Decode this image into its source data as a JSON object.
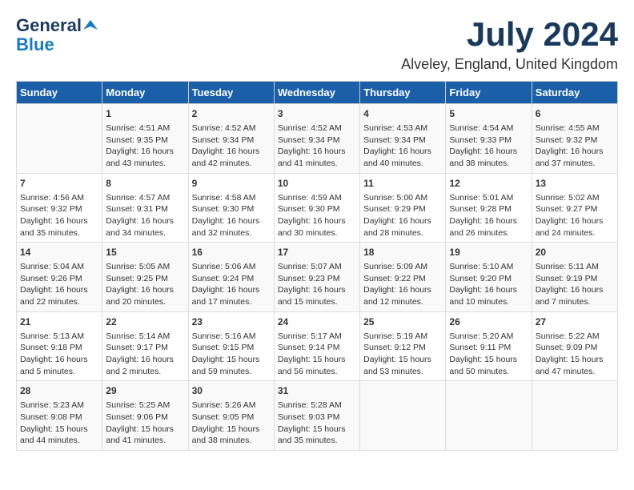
{
  "logo": {
    "general": "General",
    "blue": "Blue"
  },
  "header": {
    "month_year": "July 2024",
    "location": "Alveley, England, United Kingdom"
  },
  "weekdays": [
    "Sunday",
    "Monday",
    "Tuesday",
    "Wednesday",
    "Thursday",
    "Friday",
    "Saturday"
  ],
  "weeks": [
    [
      {
        "day": "",
        "info": ""
      },
      {
        "day": "1",
        "info": "Sunrise: 4:51 AM\nSunset: 9:35 PM\nDaylight: 16 hours\nand 43 minutes."
      },
      {
        "day": "2",
        "info": "Sunrise: 4:52 AM\nSunset: 9:34 PM\nDaylight: 16 hours\nand 42 minutes."
      },
      {
        "day": "3",
        "info": "Sunrise: 4:52 AM\nSunset: 9:34 PM\nDaylight: 16 hours\nand 41 minutes."
      },
      {
        "day": "4",
        "info": "Sunrise: 4:53 AM\nSunset: 9:34 PM\nDaylight: 16 hours\nand 40 minutes."
      },
      {
        "day": "5",
        "info": "Sunrise: 4:54 AM\nSunset: 9:33 PM\nDaylight: 16 hours\nand 38 minutes."
      },
      {
        "day": "6",
        "info": "Sunrise: 4:55 AM\nSunset: 9:32 PM\nDaylight: 16 hours\nand 37 minutes."
      }
    ],
    [
      {
        "day": "7",
        "info": "Sunrise: 4:56 AM\nSunset: 9:32 PM\nDaylight: 16 hours\nand 35 minutes."
      },
      {
        "day": "8",
        "info": "Sunrise: 4:57 AM\nSunset: 9:31 PM\nDaylight: 16 hours\nand 34 minutes."
      },
      {
        "day": "9",
        "info": "Sunrise: 4:58 AM\nSunset: 9:30 PM\nDaylight: 16 hours\nand 32 minutes."
      },
      {
        "day": "10",
        "info": "Sunrise: 4:59 AM\nSunset: 9:30 PM\nDaylight: 16 hours\nand 30 minutes."
      },
      {
        "day": "11",
        "info": "Sunrise: 5:00 AM\nSunset: 9:29 PM\nDaylight: 16 hours\nand 28 minutes."
      },
      {
        "day": "12",
        "info": "Sunrise: 5:01 AM\nSunset: 9:28 PM\nDaylight: 16 hours\nand 26 minutes."
      },
      {
        "day": "13",
        "info": "Sunrise: 5:02 AM\nSunset: 9:27 PM\nDaylight: 16 hours\nand 24 minutes."
      }
    ],
    [
      {
        "day": "14",
        "info": "Sunrise: 5:04 AM\nSunset: 9:26 PM\nDaylight: 16 hours\nand 22 minutes."
      },
      {
        "day": "15",
        "info": "Sunrise: 5:05 AM\nSunset: 9:25 PM\nDaylight: 16 hours\nand 20 minutes."
      },
      {
        "day": "16",
        "info": "Sunrise: 5:06 AM\nSunset: 9:24 PM\nDaylight: 16 hours\nand 17 minutes."
      },
      {
        "day": "17",
        "info": "Sunrise: 5:07 AM\nSunset: 9:23 PM\nDaylight: 16 hours\nand 15 minutes."
      },
      {
        "day": "18",
        "info": "Sunrise: 5:09 AM\nSunset: 9:22 PM\nDaylight: 16 hours\nand 12 minutes."
      },
      {
        "day": "19",
        "info": "Sunrise: 5:10 AM\nSunset: 9:20 PM\nDaylight: 16 hours\nand 10 minutes."
      },
      {
        "day": "20",
        "info": "Sunrise: 5:11 AM\nSunset: 9:19 PM\nDaylight: 16 hours\nand 7 minutes."
      }
    ],
    [
      {
        "day": "21",
        "info": "Sunrise: 5:13 AM\nSunset: 9:18 PM\nDaylight: 16 hours\nand 5 minutes."
      },
      {
        "day": "22",
        "info": "Sunrise: 5:14 AM\nSunset: 9:17 PM\nDaylight: 16 hours\nand 2 minutes."
      },
      {
        "day": "23",
        "info": "Sunrise: 5:16 AM\nSunset: 9:15 PM\nDaylight: 15 hours\nand 59 minutes."
      },
      {
        "day": "24",
        "info": "Sunrise: 5:17 AM\nSunset: 9:14 PM\nDaylight: 15 hours\nand 56 minutes."
      },
      {
        "day": "25",
        "info": "Sunrise: 5:19 AM\nSunset: 9:12 PM\nDaylight: 15 hours\nand 53 minutes."
      },
      {
        "day": "26",
        "info": "Sunrise: 5:20 AM\nSunset: 9:11 PM\nDaylight: 15 hours\nand 50 minutes."
      },
      {
        "day": "27",
        "info": "Sunrise: 5:22 AM\nSunset: 9:09 PM\nDaylight: 15 hours\nand 47 minutes."
      }
    ],
    [
      {
        "day": "28",
        "info": "Sunrise: 5:23 AM\nSunset: 9:08 PM\nDaylight: 15 hours\nand 44 minutes."
      },
      {
        "day": "29",
        "info": "Sunrise: 5:25 AM\nSunset: 9:06 PM\nDaylight: 15 hours\nand 41 minutes."
      },
      {
        "day": "30",
        "info": "Sunrise: 5:26 AM\nSunset: 9:05 PM\nDaylight: 15 hours\nand 38 minutes."
      },
      {
        "day": "31",
        "info": "Sunrise: 5:28 AM\nSunset: 9:03 PM\nDaylight: 15 hours\nand 35 minutes."
      },
      {
        "day": "",
        "info": ""
      },
      {
        "day": "",
        "info": ""
      },
      {
        "day": "",
        "info": ""
      }
    ]
  ]
}
